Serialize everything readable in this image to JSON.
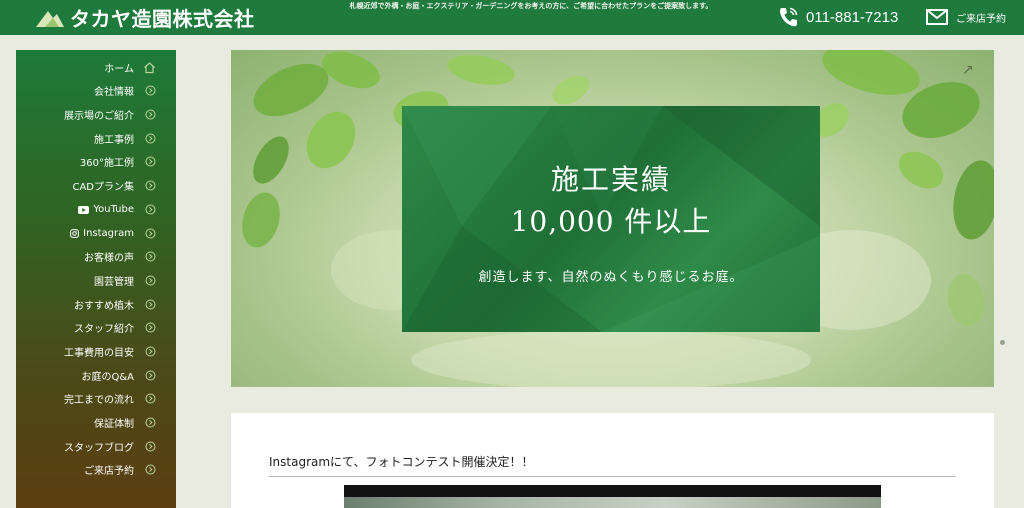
{
  "header": {
    "logo_text": "タカヤ造園株式会社",
    "tagline": "札幌近郊で外構・お庭・エクステリア・ガーデニングをお考えの方に、ご希望に合わせたプランをご提案致します。",
    "phone": "011-881-7213",
    "reserve_label": "ご来店予約"
  },
  "sidebar": {
    "items": [
      {
        "label": "ホーム",
        "icon": "home-icon"
      },
      {
        "label": "会社情報",
        "icon": "arrow-circle-icon"
      },
      {
        "label": "展示場のご紹介",
        "icon": "arrow-circle-icon"
      },
      {
        "label": "施工事例",
        "icon": "arrow-circle-icon"
      },
      {
        "label": "360°施工例",
        "icon": "arrow-circle-icon"
      },
      {
        "label": "CADプラン集",
        "icon": "arrow-circle-icon"
      },
      {
        "label": "YouTube",
        "icon": "arrow-circle-icon"
      },
      {
        "label": "Instagram",
        "icon": "arrow-circle-icon"
      },
      {
        "label": "お客様の声",
        "icon": "arrow-circle-icon"
      },
      {
        "label": "園芸管理",
        "icon": "arrow-circle-icon"
      },
      {
        "label": "おすすめ植木",
        "icon": "arrow-circle-icon"
      },
      {
        "label": "スタッフ紹介",
        "icon": "arrow-circle-icon"
      },
      {
        "label": "工事費用の目安",
        "icon": "arrow-circle-icon"
      },
      {
        "label": "お庭のQ&A",
        "icon": "arrow-circle-icon"
      },
      {
        "label": "完工までの流れ",
        "icon": "arrow-circle-icon"
      },
      {
        "label": "保証体制",
        "icon": "arrow-circle-icon"
      },
      {
        "label": "スタッフブログ",
        "icon": "arrow-circle-icon"
      },
      {
        "label": "ご来店予約",
        "icon": "arrow-circle-icon"
      }
    ]
  },
  "hero": {
    "title_line1": "施工実績",
    "title_line2": "10,000 件以上",
    "subtitle": "創造します、自然のぬくもり感じるお庭。"
  },
  "post": {
    "title": "Instagramにて、フォトコンテスト開催決定！！"
  },
  "colors": {
    "brand_green": "#1f7a3d",
    "sidebar_top": "#1e7a38",
    "sidebar_bottom": "#5c3e10",
    "page_bg": "#e9ebe1"
  }
}
